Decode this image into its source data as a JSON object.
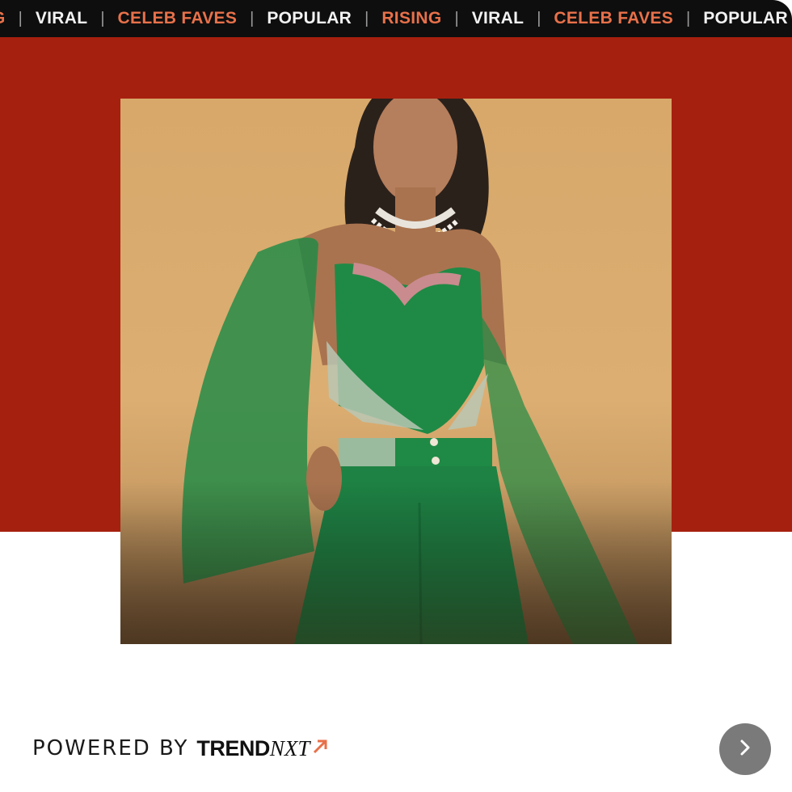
{
  "ticker": {
    "items": [
      {
        "label": "G",
        "accent": true
      },
      {
        "label": "VIRAL",
        "accent": false
      },
      {
        "label": "CELEB FAVES",
        "accent": true
      },
      {
        "label": "POPULAR",
        "accent": false
      },
      {
        "label": "RISING",
        "accent": true
      },
      {
        "label": "VIRAL",
        "accent": false
      },
      {
        "label": "CELEB FAVES",
        "accent": true
      },
      {
        "label": "POPULAR",
        "accent": false
      }
    ],
    "separator": "|"
  },
  "colors": {
    "band": "#a6200f",
    "ticker_bg": "#0e0e0e",
    "accent": "#e8714a",
    "button": "#7a7a7a",
    "outfit": "#1f8a45"
  },
  "footer": {
    "powered_by": "POWERED BY",
    "brand_name": "TREND",
    "brand_suffix": "NXT",
    "brand_icon": "arrow-up-right-icon"
  },
  "next_button": {
    "icon": "chevron-right-icon"
  }
}
